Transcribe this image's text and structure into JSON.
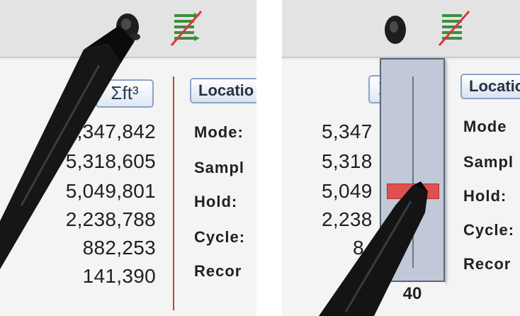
{
  "left_panel": {
    "units_button": "Σft³",
    "counts": [
      "5,347,842",
      "5,318,605",
      "5,049,801",
      "2,238,788",
      "882,253",
      "141,390"
    ],
    "location_tab": "Locatio",
    "labels": [
      "Mode:",
      "Sampl",
      "Hold:",
      "Cycle:",
      "Recor"
    ]
  },
  "right_panel": {
    "units_button": "Σ",
    "counts": [
      "5,347",
      "5,318",
      "5,049",
      "2,238",
      "8"
    ],
    "location_tab": "Locatio",
    "labels": [
      "Mode",
      "Sampl",
      "Hold:",
      "Cycle:",
      "Recor"
    ],
    "slider": {
      "value_label": "40",
      "level_fraction": 0.4,
      "thumb_color": "#e05050"
    }
  },
  "icons": {
    "camera": "camera-icon",
    "list_disabled": "list-disabled-icon",
    "stylus": "stylus-pen"
  },
  "colors": {
    "accent_button_border": "#8aa3c8",
    "divider_red": "#b5473f",
    "slider_bg": "#c1c9d8"
  }
}
